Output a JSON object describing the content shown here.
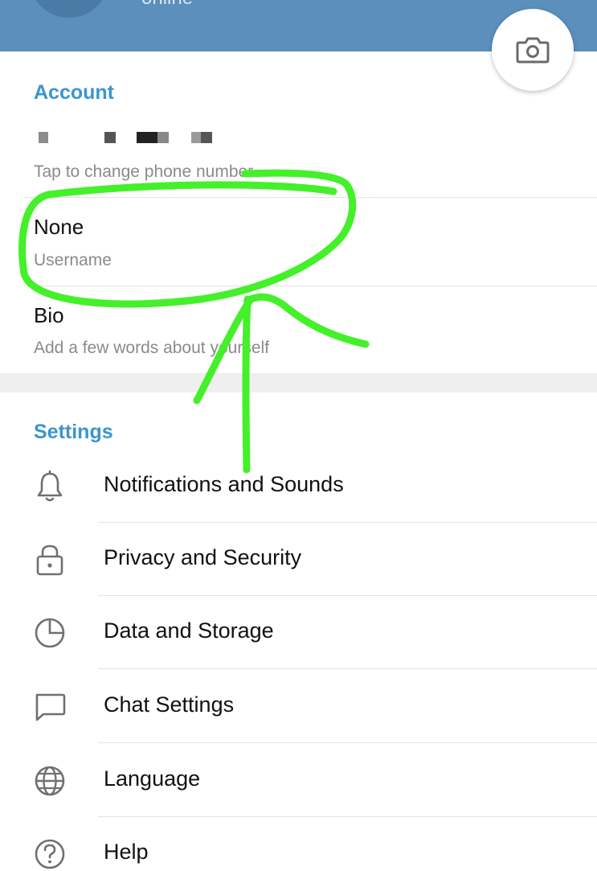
{
  "header": {
    "status": "online"
  },
  "account": {
    "title": "Account",
    "phone_hint": "Tap to change phone number",
    "username_value": "None",
    "username_label": "Username",
    "bio_value": "Bio",
    "bio_hint": "Add a few words about yourself"
  },
  "settings": {
    "title": "Settings",
    "items": [
      {
        "label": "Notifications and Sounds",
        "icon": "bell-icon"
      },
      {
        "label": "Privacy and Security",
        "icon": "lock-icon"
      },
      {
        "label": "Data and Storage",
        "icon": "pie-chart-icon"
      },
      {
        "label": "Chat Settings",
        "icon": "chat-bubble-icon"
      },
      {
        "label": "Language",
        "icon": "globe-icon"
      },
      {
        "label": "Help",
        "icon": "help-icon"
      }
    ]
  },
  "colors": {
    "header": "#5b8fbc",
    "accent": "#3a95d0",
    "annotation": "#44f02a"
  }
}
